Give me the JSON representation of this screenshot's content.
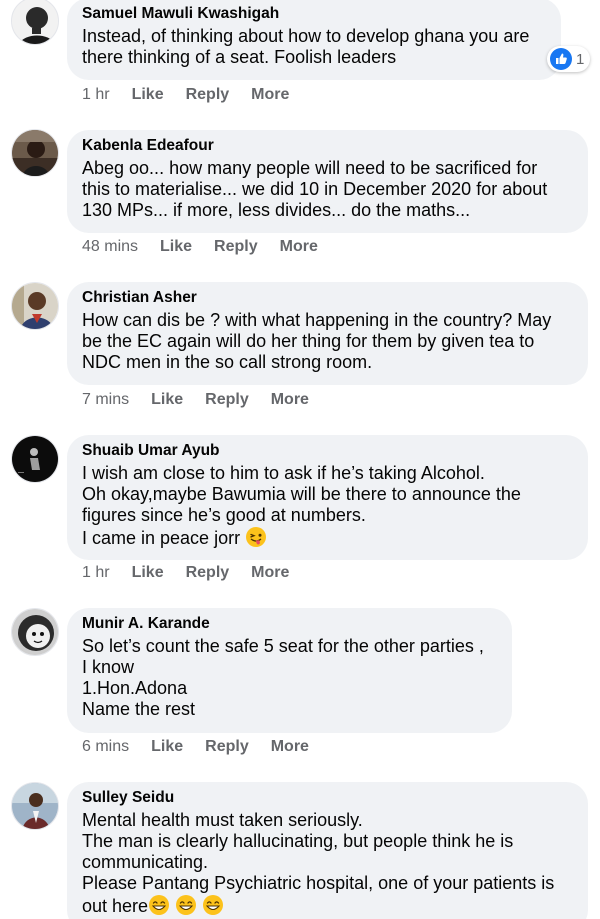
{
  "comments": [
    {
      "name": "Samuel Mawuli Kwashigah",
      "lines": [
        "Instead, of thinking about how to develop ghana you are",
        "there thinking of a seat. Foolish leaders"
      ],
      "time": "1 hr",
      "actions": [
        "Like",
        "Reply",
        "More"
      ],
      "reaction_count": "1"
    },
    {
      "name": "Kabenla Edeafour",
      "lines": [
        "Abeg oo... how many people will need to be sacrificed for",
        "this to materialise... we did 10 in December 2020 for about",
        "130 MPs... if more, less divides... do the maths..."
      ],
      "time": "48 mins",
      "actions": [
        "Like",
        "Reply",
        "More"
      ]
    },
    {
      "name": "Christian Asher",
      "lines": [
        "How can dis be ? with what happening in the country? May",
        "be the EC again will do her thing for them by given tea to",
        "NDC men in the so call strong room."
      ],
      "time": "7 mins",
      "actions": [
        "Like",
        "Reply",
        "More"
      ]
    },
    {
      "name": "Shuaib Umar Ayub",
      "lines": [
        "I wish am close to him to ask if he’s taking Alcohol.",
        "Oh okay,maybe Bawumia will be there to announce the",
        "figures since he’s good at numbers.",
        "I came in peace jorr"
      ],
      "time": "1 hr",
      "actions": [
        "Like",
        "Reply",
        "More"
      ]
    },
    {
      "name": "Munir A. Karande",
      "lines": [
        "So let’s count the safe 5 seat for the other parties ,",
        "I know",
        "1.Hon.Adona",
        "Name the rest"
      ],
      "time": "6 mins",
      "actions": [
        "Like",
        "Reply",
        "More"
      ]
    },
    {
      "name": "Sulley Seidu",
      "lines": [
        "Mental health must taken seriously.",
        "The man is clearly hallucinating, but people think he is",
        "communicating.",
        "Please Pantang Psychiatric hospital, one of your patients is",
        "out here"
      ]
    }
  ],
  "emojis": {
    "wink_tongue": "winking-face-with-tongue-icon",
    "grin": "grinning-face-with-smiling-eyes-icon"
  },
  "colors": {
    "bubble": "#f0f2f5",
    "meta_text": "#65676b",
    "like_blue": "#1877f2"
  }
}
